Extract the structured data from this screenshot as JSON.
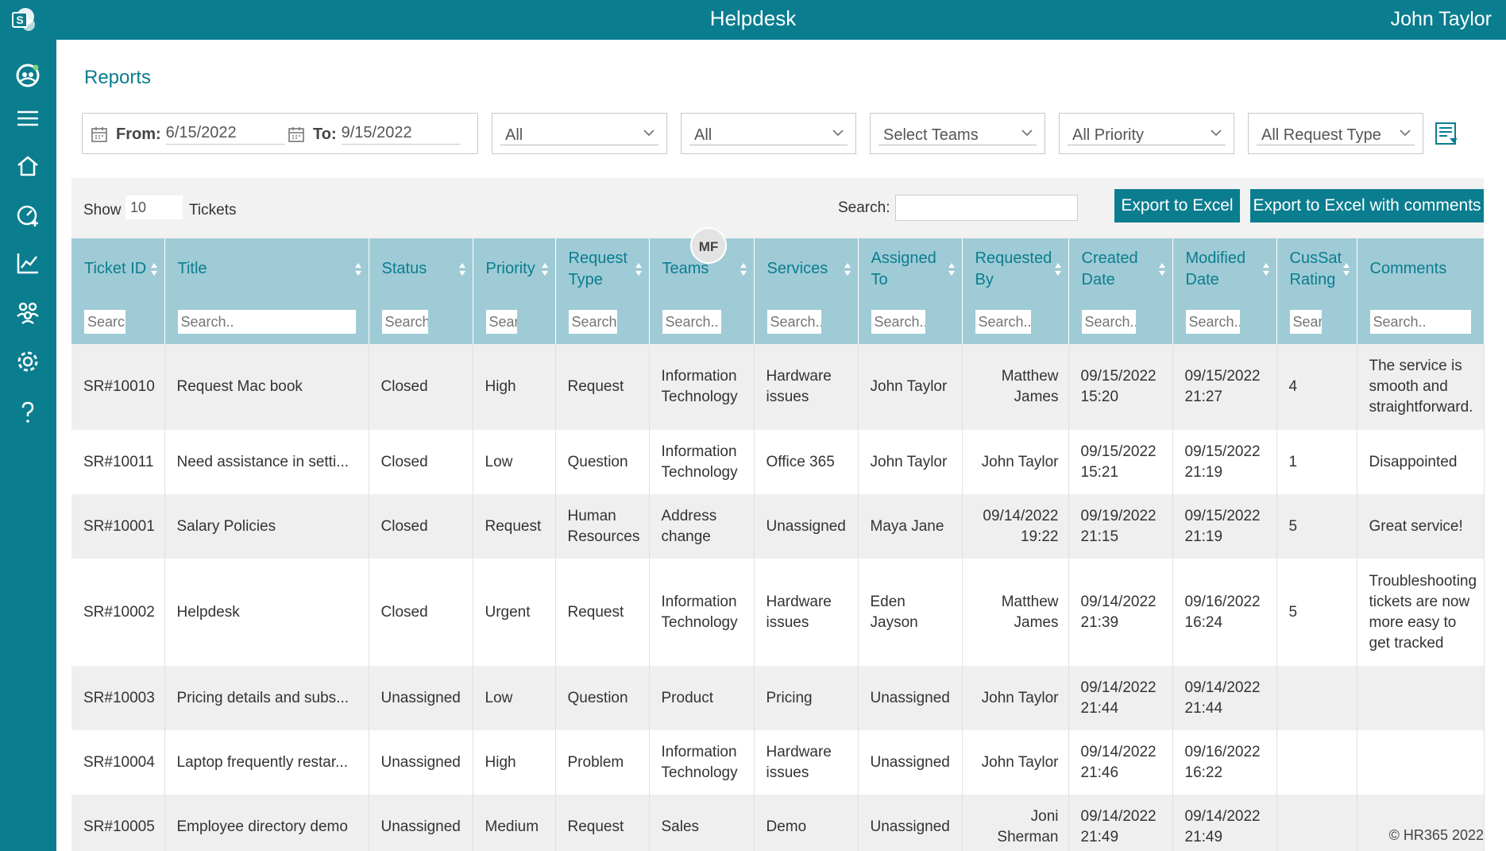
{
  "header": {
    "title": "Helpdesk",
    "user": "John Taylor"
  },
  "sidebar": {
    "items": [
      "team-icon",
      "menu-icon",
      "home-icon",
      "dashboard-icon",
      "chart-icon",
      "users-icon",
      "settings-icon",
      "help-icon"
    ]
  },
  "page": {
    "title": "Reports"
  },
  "filters": {
    "from_label": "From:",
    "from_value": "6/15/2022",
    "to_label": "To:",
    "to_value": "9/15/2022",
    "selects": [
      "All",
      "All",
      "Select Teams",
      "All Priority",
      "All Request Type"
    ]
  },
  "toolbar": {
    "show_label": "Show",
    "show_value": "10",
    "tickets_label": "Tickets",
    "search_label": "Search:",
    "export_label": "Export to Excel",
    "export_comments_label": "Export to Excel with comments"
  },
  "table": {
    "columns": [
      "Ticket ID",
      "Title",
      "Status",
      "Priority",
      "Request Type",
      "Teams",
      "Services",
      "Assigned To",
      "Requested By",
      "Created Date",
      "Modified Date",
      "CusSat Rating",
      "Comments"
    ],
    "search_placeholder": "Search..",
    "rows": [
      [
        "SR#10010",
        "Request Mac book",
        "Closed",
        "High",
        "Request",
        "Information Technology",
        "Hardware issues",
        "John Taylor",
        "Matthew James",
        "09/15/2022 15:20",
        "09/15/2022 21:27",
        "4",
        "The service is smooth and straightforward."
      ],
      [
        "SR#10011",
        "Need assistance in setti...",
        "Closed",
        "Low",
        "Question",
        "Information Technology",
        "Office 365",
        "John Taylor",
        "John Taylor",
        "09/15/2022 15:21",
        "09/15/2022 21:19",
        "1",
        "Disappointed"
      ],
      [
        "SR#10001",
        "Salary Policies",
        "Closed",
        "Request",
        "Human Resources",
        "Address change",
        "Unassigned",
        "Maya Jane",
        "09/14/2022 19:22",
        "09/19/2022 21:15",
        "09/15/2022 21:19",
        "5",
        "Great service!"
      ],
      [
        "SR#10002",
        "Helpdesk",
        "Closed",
        "Urgent",
        "Request",
        "Information Technology",
        "Hardware issues",
        "Eden Jayson",
        "Matthew James",
        "09/14/2022 21:39",
        "09/16/2022 16:24",
        "5",
        "Troubleshooting tickets are now more easy to get tracked"
      ],
      [
        "SR#10003",
        "Pricing details and subs...",
        "Unassigned",
        "Low",
        "Question",
        "Product",
        "Pricing",
        "Unassigned",
        "John Taylor",
        "09/14/2022 21:44",
        "09/14/2022 21:44",
        "",
        ""
      ],
      [
        "SR#10004",
        "Laptop frequently restar...",
        "Unassigned",
        "High",
        "Problem",
        "Information Technology",
        "Hardware issues",
        "Unassigned",
        "John Taylor",
        "09/14/2022 21:46",
        "09/16/2022 16:22",
        "",
        ""
      ],
      [
        "SR#10005",
        "Employee directory demo",
        "Unassigned",
        "Medium",
        "Request",
        "Sales",
        "Demo",
        "Unassigned",
        "Joni Sherman",
        "09/14/2022 21:49",
        "09/14/2022 21:49",
        "",
        ""
      ]
    ]
  },
  "avatar": {
    "initials": "MF"
  },
  "footer": {
    "copyright": "© HR365 2022"
  },
  "colors": {
    "primary": "#0a7d8f",
    "header_row": "#9fcbd6",
    "odd_row": "#efefef"
  }
}
